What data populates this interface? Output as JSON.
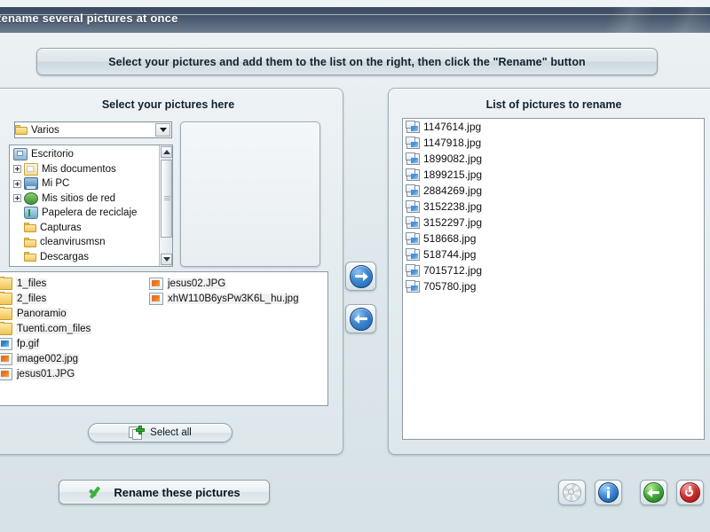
{
  "window": {
    "title": "Rename several pictures at once"
  },
  "banner": {
    "text": "Select your pictures and add them to the list on the right, then click the \"Rename\" button"
  },
  "left_panel": {
    "title": "Select your pictures here",
    "folder_combo": {
      "value": "Varios"
    },
    "tree": [
      {
        "label": "Escritorio",
        "icon": "desktop-icon",
        "expander": false,
        "indent": 0
      },
      {
        "label": "Mis documentos",
        "icon": "documents-icon",
        "expander": true,
        "indent": 1
      },
      {
        "label": "Mi PC",
        "icon": "computer-icon",
        "expander": true,
        "indent": 1
      },
      {
        "label": "Mis sitios de red",
        "icon": "network-icon",
        "expander": true,
        "indent": 1
      },
      {
        "label": "Papelera de reciclaje",
        "icon": "recycle-bin-icon",
        "expander": false,
        "indent": 1
      },
      {
        "label": "Capturas",
        "icon": "folder-icon",
        "expander": false,
        "indent": 1
      },
      {
        "label": "cleanvirusmsn",
        "icon": "folder-icon",
        "expander": false,
        "indent": 1
      },
      {
        "label": "Descargas",
        "icon": "folder-icon",
        "expander": false,
        "indent": 1
      }
    ],
    "files_column_1": [
      {
        "name": "1_files",
        "icon": "folder-icon"
      },
      {
        "name": "2_files",
        "icon": "folder-icon"
      },
      {
        "name": "Panoramio",
        "icon": "folder-icon"
      },
      {
        "name": "Tuenti.com_files",
        "icon": "folder-icon"
      },
      {
        "name": "fp.gif",
        "icon": "gif-file-icon"
      },
      {
        "name": "image002.jpg",
        "icon": "jpg-file-icon"
      },
      {
        "name": "jesus01.JPG",
        "icon": "jpg-file-icon"
      }
    ],
    "files_column_2": [
      {
        "name": "jesus02.JPG",
        "icon": "jpg-file-icon"
      },
      {
        "name": "xhW110B6ysPw3K6L_hu.jpg",
        "icon": "jpg-file-icon"
      }
    ],
    "select_all_label": "Select all"
  },
  "transfer": {
    "add_icon": "arrow-right-icon",
    "remove_icon": "arrow-left-icon"
  },
  "right_panel": {
    "title": "List of pictures to rename",
    "items": [
      "1147614.jpg",
      "1147918.jpg",
      "1899082.jpg",
      "1899215.jpg",
      "2884269.jpg",
      "3152238.jpg",
      "3152297.jpg",
      "518668.jpg",
      "518744.jpg",
      "7015712.jpg",
      "705780.jpg"
    ]
  },
  "footer": {
    "rename_label": "Rename these pictures",
    "buttons": [
      {
        "name": "settings-button",
        "icon": "gear-icon"
      },
      {
        "name": "info-button",
        "icon": "info-icon"
      },
      {
        "name": "back-button",
        "icon": "back-arrow-icon"
      },
      {
        "name": "exit-button",
        "icon": "power-icon"
      }
    ]
  },
  "colors": {
    "titlebar_dark": "#3c4b60",
    "titlebar_light": "#6d7d8e",
    "background": "#e3eaed",
    "accent_blue": "#3f86d1",
    "accent_green": "#44ab3c",
    "accent_red": "#cf3030"
  }
}
